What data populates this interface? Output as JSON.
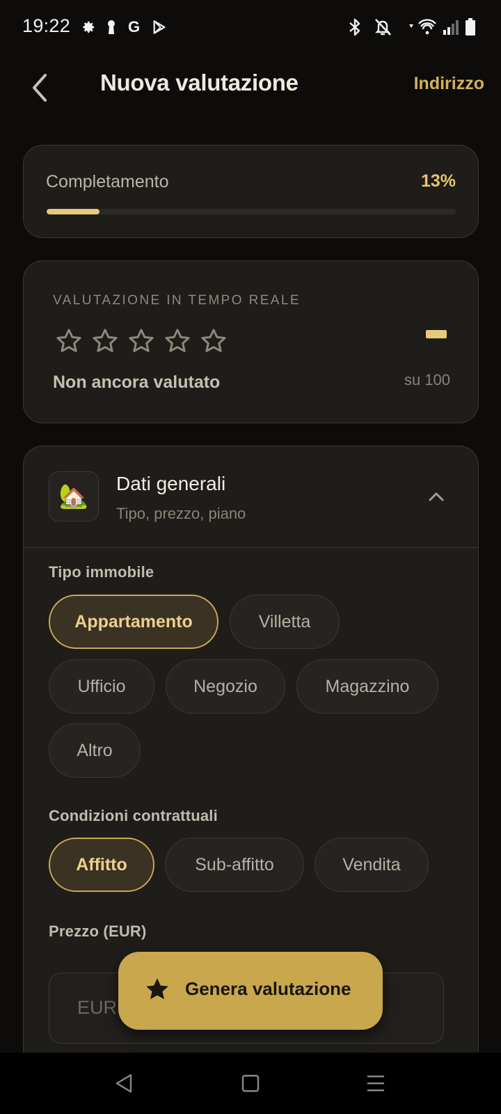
{
  "status_bar": {
    "time": "19:22",
    "left_icons": [
      "settings-icon",
      "keyhole-icon",
      "google-icon",
      "play-store-icon"
    ],
    "right_icons": [
      "bluetooth-icon",
      "notifications-off-icon",
      "wifi-icon",
      "signal-icon",
      "battery-icon"
    ],
    "google_glyph": "G"
  },
  "app_bar": {
    "title": "Nuova valutazione",
    "action": "Indirizzo"
  },
  "progress": {
    "label": "Completamento",
    "value_text": "13%",
    "value": 0.13
  },
  "rating": {
    "caption": "VALUTAZIONE IN TEMPO REALE",
    "stars_total": 5,
    "stars_filled": 0,
    "status": "Non ancora valutato",
    "score": "–",
    "score_suffix": "su 100"
  },
  "section": {
    "icon": "house-icon",
    "icon_glyph": "🏡",
    "title": "Dati generali",
    "subtitle": "Tipo, prezzo, piano",
    "expanded": true
  },
  "property_type": {
    "label": "Tipo immobile",
    "options": [
      "Appartamento",
      "Villetta",
      "Ufficio",
      "Negozio",
      "Magazzino",
      "Altro"
    ],
    "selected": "Appartamento"
  },
  "contract": {
    "label": "Condizioni contrattuali",
    "options": [
      "Affitto",
      "Sub-affitto",
      "Vendita"
    ],
    "selected": "Affitto"
  },
  "price": {
    "label": "Prezzo (EUR)",
    "placeholder": "EUR"
  },
  "fab": {
    "label": "Genera valutazione",
    "icon": "star-icon"
  },
  "colors": {
    "accent": "#c9a74d",
    "accent_light": "#e8c97a",
    "background": "#0d0c0b",
    "card": "#1f1d1a"
  }
}
